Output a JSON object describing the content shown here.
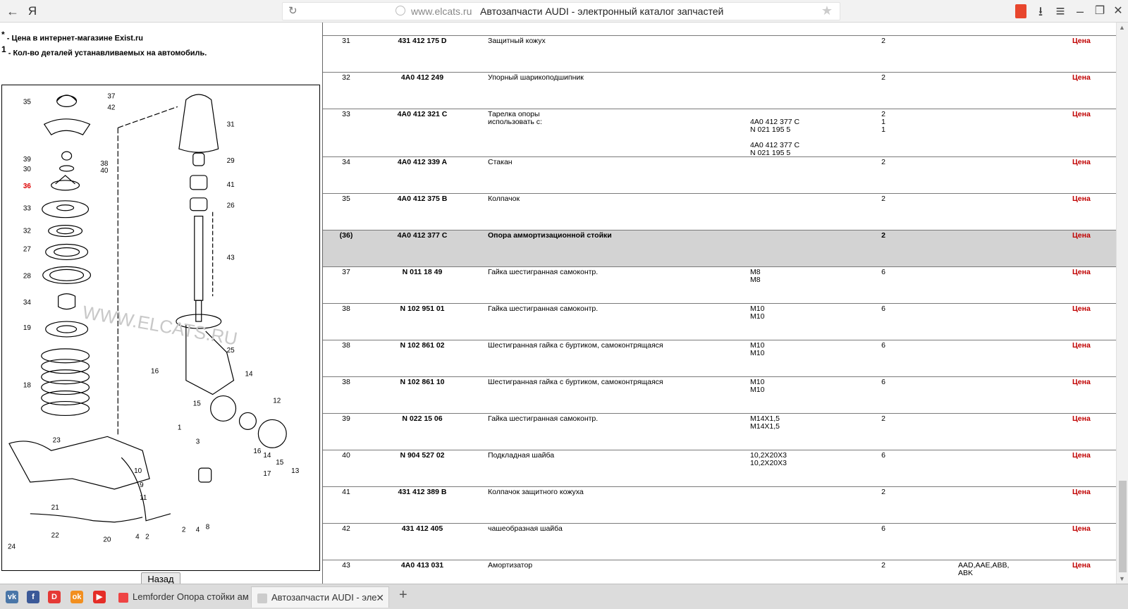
{
  "browser": {
    "back_icon": "←",
    "yandex_label": "Я",
    "url_domain": "www.elcats.ru",
    "page_title": "Автозапчасти AUDI - электронный каталог запчастей",
    "download_icon": "⭳",
    "menu_icon": "≡",
    "minimize_icon": "‒",
    "restore_icon": "❐",
    "close_icon": "✕"
  },
  "left": {
    "note1_sup": "*",
    "note1_text": " - Цена в интернет-магазине Exist.ru",
    "note2_sup": "1",
    "note2_text": " - Кол-во деталей устанавливаемых на автомобиль.",
    "back_button": "Назад",
    "watermark": "WWW.ELCATS.RU",
    "callouts": [
      "35",
      "37",
      "42",
      "31",
      "39",
      "38",
      "30",
      "40",
      "29",
      "36",
      "41",
      "33",
      "26",
      "32",
      "27",
      "43",
      "28",
      "34",
      "19",
      "25",
      "16",
      "14",
      "18",
      "12",
      "15",
      "1",
      "23",
      "3",
      "10",
      "16",
      "14",
      "15",
      "9",
      "17",
      "13",
      "11",
      "21",
      "22",
      "2",
      "4",
      "8",
      "20",
      "4",
      "2",
      "24"
    ]
  },
  "rows": [
    {
      "no": "31",
      "art": "431 412 175 D",
      "name": "Защитный кожух",
      "spec": "",
      "qty": "2",
      "models": "",
      "price": "Цена"
    },
    {
      "no": "32",
      "art": "4A0 412 249",
      "name": "Упорный шарикоподшипник",
      "spec": "",
      "qty": "2",
      "models": "",
      "price": "Цена"
    },
    {
      "no": "33",
      "art": "4A0 412 321 C",
      "name": "Тарелка опоры\nиспользовать с:",
      "spec": "\n4A0 412 377 C\nN 021 195 5\n\n4A0 412 377 C\nN 021 195 5",
      "qty": "2\n1\n1",
      "models": "",
      "price": "Цена"
    },
    {
      "no": "34",
      "art": "4A0 412 339 A",
      "name": "Стакан",
      "spec": "",
      "qty": "2",
      "models": "",
      "price": "Цена"
    },
    {
      "no": "35",
      "art": "4A0 412 375 B",
      "name": "Колпачок",
      "spec": "",
      "qty": "2",
      "models": "",
      "price": "Цена"
    },
    {
      "no": "(36)",
      "art": "4A0 412 377 C",
      "name": "Опора аммортизационной стойки",
      "spec": "",
      "qty": "2",
      "models": "",
      "price": "Цена",
      "highlight": true
    },
    {
      "no": "37",
      "art": "N 011 18 49",
      "name": "Гайка шестигранная самоконтр.",
      "spec": "M8\nM8",
      "qty": "6",
      "models": "",
      "price": "Цена"
    },
    {
      "no": "38",
      "art": "N 102 951 01",
      "name": "Гайка шестигранная самоконтр.",
      "spec": "M10\nM10",
      "qty": "6",
      "models": "",
      "price": "Цена"
    },
    {
      "no": "38",
      "art": "N 102 861 02",
      "name": "Шестигранная гайка с буртиком, самоконтрящаяся",
      "spec": "M10\nM10",
      "qty": "6",
      "models": "",
      "price": "Цена"
    },
    {
      "no": "38",
      "art": "N 102 861 10",
      "name": "Шестигранная гайка с буртиком, самоконтрящаяся",
      "spec": "M10\nM10",
      "qty": "6",
      "models": "",
      "price": "Цена"
    },
    {
      "no": "39",
      "art": "N 022 15 06",
      "name": "Гайка шестигранная самоконтр.",
      "spec": "M14X1,5\nM14X1,5",
      "qty": "2",
      "models": "",
      "price": "Цена"
    },
    {
      "no": "40",
      "art": "N 904 527 02",
      "name": "Подкладная шайба",
      "spec": "10,2X20X3\n10,2X20X3",
      "qty": "6",
      "models": "",
      "price": "Цена"
    },
    {
      "no": "41",
      "art": "431 412 389 B",
      "name": "Колпачок защитного кожуха",
      "spec": "",
      "qty": "2",
      "models": "",
      "price": "Цена"
    },
    {
      "no": "42",
      "art": "431 412 405",
      "name": "чашеобразная шайба",
      "spec": "",
      "qty": "6",
      "models": "",
      "price": "Цена"
    },
    {
      "no": "43",
      "art": "4A0 413 031",
      "name": "Амортизатор",
      "spec": "",
      "qty": "2",
      "models": "AAD,AAE,ABB,\nABK",
      "price": "Цена"
    }
  ],
  "taskbar": {
    "tabs": [
      {
        "label": "Lemforder Опора стойки ам"
      },
      {
        "label": "Автозапчасти AUDI - эле"
      }
    ],
    "new_tab": "+",
    "close_x": "✕"
  }
}
